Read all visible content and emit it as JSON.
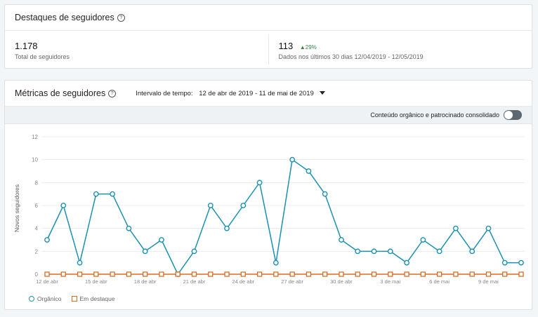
{
  "highlights": {
    "title": "Destaques de seguidores",
    "total_value": "1.178",
    "total_label": "Total de seguidores",
    "new_value": "113",
    "new_trend": "▲29%",
    "new_label": "Dados nos últimos 30 dias 12/04/2019 - 12/05/2019"
  },
  "metrics": {
    "title": "Métricas de seguidores",
    "range_label": "Intervalo de tempo:",
    "range_value": "12 de abr de 2019 - 11 de mai de 2019",
    "toggle_label": "Conteúdo orgânico e patrocinado consolidado",
    "toggle_on": false
  },
  "chart_data": {
    "type": "line",
    "ylabel": "Novos seguidores",
    "ylim": [
      0,
      12
    ],
    "yticks": [
      0,
      2,
      4,
      6,
      8,
      10,
      12
    ],
    "x_ticks": [
      "12 de abr",
      "15 de abr",
      "18 de abr",
      "21 de abr",
      "24 de abr",
      "27 de abr",
      "30 de abr",
      "3 de mai",
      "6 de mai",
      "9 de mai"
    ],
    "x_tick_every": 3,
    "colors": {
      "organic": "#1b90b2",
      "sponsored": "#dd6b20"
    },
    "series": [
      {
        "name": "Orgânico",
        "values": [
          3,
          6,
          1,
          7,
          7,
          4,
          2,
          3,
          0,
          2,
          6,
          4,
          6,
          8,
          1,
          10,
          9,
          7,
          3,
          2,
          2,
          2,
          1,
          3,
          2,
          4,
          2,
          4,
          1,
          1
        ]
      },
      {
        "name": "Em destaque",
        "values": [
          0,
          0,
          0,
          0,
          0,
          0,
          0,
          0,
          0,
          0,
          0,
          0,
          0,
          0,
          0,
          0,
          0,
          0,
          0,
          0,
          0,
          0,
          0,
          0,
          0,
          0,
          0,
          0,
          0,
          0
        ]
      }
    ],
    "grid": true
  }
}
